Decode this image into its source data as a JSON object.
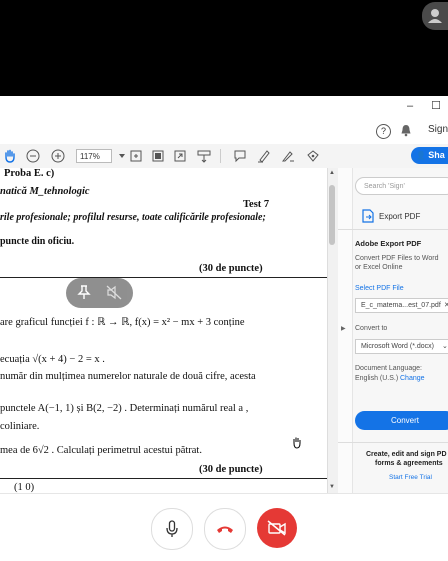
{
  "window": {
    "minimize": "–",
    "maximize": "☐"
  },
  "toolbar": {
    "help": "?",
    "sign_in": "Sign",
    "zoom": "117%",
    "share": "Sha"
  },
  "document": {
    "lines": [
      {
        "text": "Proba E. c)",
        "bold": true
      },
      {
        "text": "natică M_tehnologic",
        "bold": true,
        "italic": true
      },
      {
        "text": "Test 7",
        "bold": true
      },
      {
        "text": "rile profesionale; profilul resurse, toate calificările profesionale;",
        "bold": true,
        "italic": true
      },
      {
        "text": "puncte din oficiu.",
        "bold": true
      },
      {
        "text": "(30 de puncte)",
        "bold": true
      },
      {
        "text": "are graficul funcției  f : ℝ → ℝ,  f(x) = x² − mx + 3  conține"
      },
      {
        "text": "ecuația  √(x + 4) − 2 = x ."
      },
      {
        "text": "număr din mulțimea numerelor naturale de două cifre, acesta"
      },
      {
        "text": "punctele  A(−1, 1)  și  B(2, −2) . Determinați numărul real  a ,"
      },
      {
        "text": "coliniare."
      },
      {
        "text": "mea de 6√2 . Calculați perimetrul acestui pătrat."
      },
      {
        "text": "(30 de puncte)",
        "bold": true
      },
      {
        "text": "(1   0)"
      }
    ]
  },
  "right_pane": {
    "search_placeholder": "Search 'Sign'",
    "export_pdf": "Export PDF",
    "title": "Adobe Export PDF",
    "description_1": "Convert PDF Files to Word",
    "description_2": "or Excel Online",
    "select_pdf_label": "Select PDF File",
    "selected_file": "E_c_matema...est_07.pdf",
    "convert_to_label": "Convert to",
    "convert_to_value": "Microsoft Word (*.docx)",
    "doc_language_label": "Document Language:",
    "doc_language_value": "English (U.S.)",
    "change_link": "Change",
    "convert_button": "Convert",
    "promo_line1": "Create, edit and sign PD",
    "promo_line2": "forms & agreements",
    "trial_link": "Start Free Trial"
  },
  "colors": {
    "accent": "#1473e6",
    "hangup": "#e53935"
  }
}
